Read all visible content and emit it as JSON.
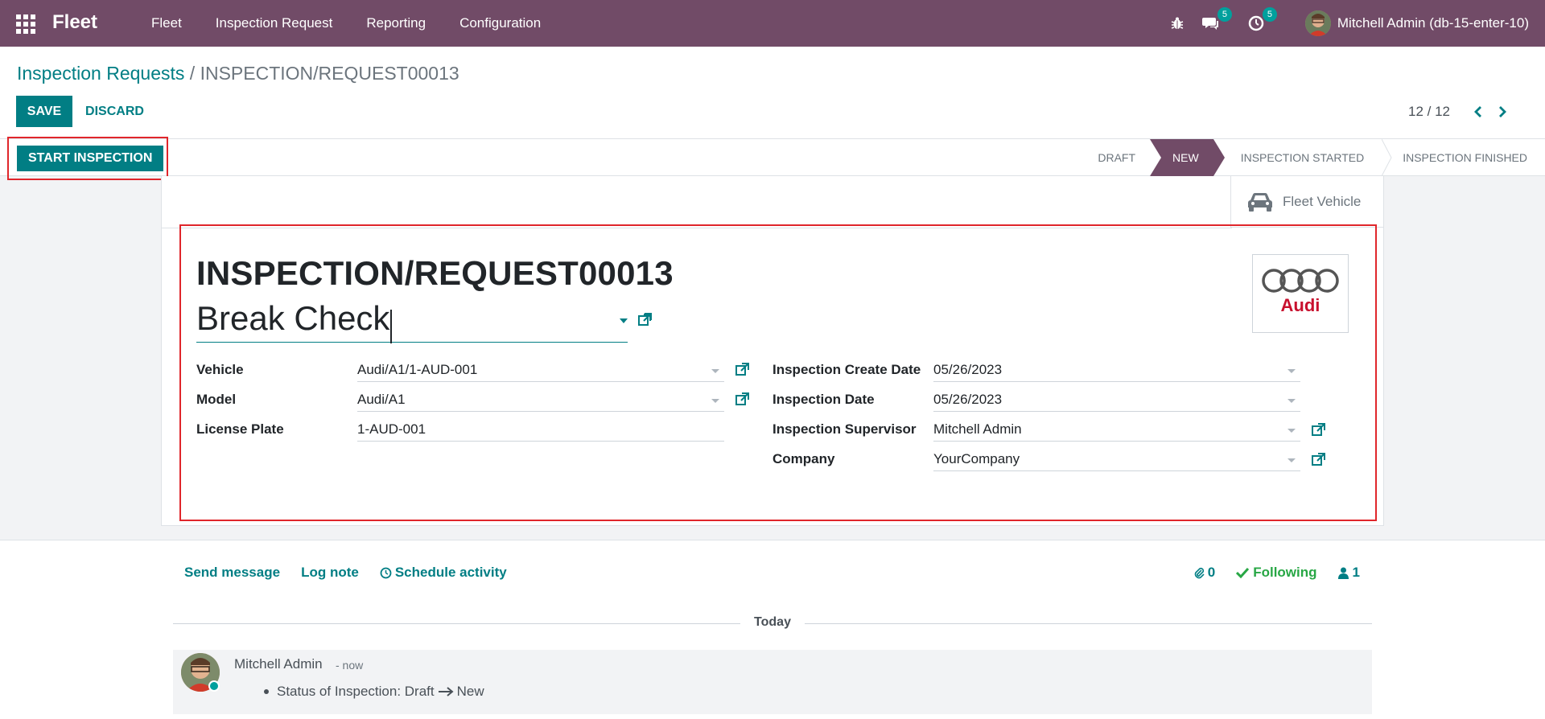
{
  "navbar": {
    "brand": "Fleet",
    "menu": [
      "Fleet",
      "Inspection Request",
      "Reporting",
      "Configuration"
    ],
    "messages_count": "5",
    "activities_count": "5",
    "user_name": "Mitchell Admin (db-15-enter-10)"
  },
  "control_panel": {
    "breadcrumb_parent": "Inspection Requests",
    "breadcrumb_separator": "/",
    "breadcrumb_current": "INSPECTION/REQUEST00013",
    "save_label": "SAVE",
    "discard_label": "DISCARD",
    "pager_value": "12 / 12"
  },
  "statusbar": {
    "action_label": "START INSPECTION",
    "stages": [
      {
        "label": "DRAFT",
        "active": false
      },
      {
        "label": "NEW",
        "active": true
      },
      {
        "label": "INSPECTION STARTED",
        "active": false
      },
      {
        "label": "INSPECTION FINISHED",
        "active": false
      }
    ]
  },
  "sheet": {
    "smart_button_label": "Fleet Vehicle",
    "record_name": "INSPECTION/REQUEST00013",
    "title_value": "Break Check",
    "logo_text": "Audi",
    "left_fields": [
      {
        "label": "Vehicle",
        "value": "Audi/A1/1-AUD-001"
      },
      {
        "label": "Model",
        "value": "Audi/A1"
      },
      {
        "label": "License Plate",
        "value": "1-AUD-001"
      }
    ],
    "right_fields": [
      {
        "label": "Inspection Create Date",
        "value": "05/26/2023"
      },
      {
        "label": "Inspection Date",
        "value": "05/26/2023"
      },
      {
        "label": "Inspection Supervisor",
        "value": "Mitchell Admin"
      },
      {
        "label": "Company",
        "value": "YourCompany"
      }
    ]
  },
  "chatter": {
    "send_message": "Send message",
    "log_note": "Log note",
    "schedule_activity": "Schedule activity",
    "attachments_count": "0",
    "following_label": "Following",
    "followers_count": "1",
    "today_label": "Today",
    "message": {
      "author": "Mitchell Admin",
      "date": "- now",
      "body_prefix": "Status of Inspection: Draft",
      "body_suffix": "New"
    }
  },
  "colors": {
    "navbar": "#714b67",
    "primary": "#017e84",
    "highlight_outline": "#e0262b",
    "following": "#28a745"
  }
}
